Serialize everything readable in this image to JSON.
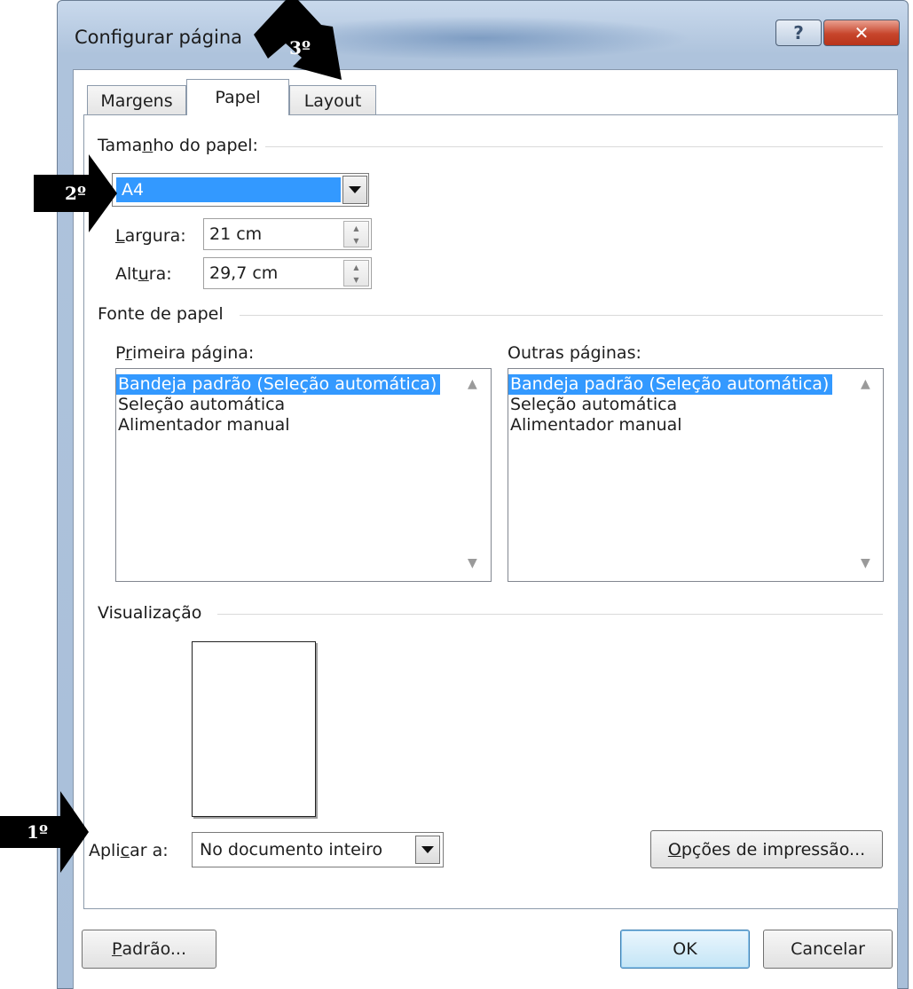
{
  "window": {
    "title": "Configurar página",
    "help_glyph": "?",
    "close_glyph": "✕"
  },
  "tabs": [
    {
      "label": "Margens",
      "active": false
    },
    {
      "label": "Papel",
      "active": true
    },
    {
      "label": "Layout",
      "active": false
    }
  ],
  "paper_size": {
    "group_label_pre": "Tama",
    "group_label_u": "n",
    "group_label_post": "ho do papel:",
    "selected": "A4"
  },
  "width": {
    "label_u": "L",
    "label_post": "argura:",
    "value": "21 cm"
  },
  "height": {
    "label_pre": "Alt",
    "label_u": "u",
    "label_post": "ra:",
    "value": "29,7 cm"
  },
  "paper_source": {
    "group_label": "Fonte de papel",
    "first_page": {
      "label_pre": "P",
      "label_u": "r",
      "label_post": "imeira página:",
      "items": [
        "Bandeja padrão (Seleção automática)",
        "Seleção automática",
        "Alimentador manual"
      ],
      "selected_index": 0
    },
    "other_pages": {
      "label_pre": "Outras pá",
      "label_u": "g",
      "label_post": "inas:",
      "items": [
        "Bandeja padrão (Seleção automática)",
        "Seleção automática",
        "Alimentador manual"
      ],
      "selected_index": 0
    }
  },
  "preview": {
    "group_label": "Visualização"
  },
  "apply_to": {
    "label_pre": "Apli",
    "label_u": "c",
    "label_post": "ar a:",
    "value": "No documento inteiro"
  },
  "buttons": {
    "print_options_u": "O",
    "print_options_post": "pções de impressão...",
    "default_u": "P",
    "default_post": "adrão...",
    "ok": "OK",
    "cancel": "Cancelar"
  },
  "markers": [
    "1º",
    "2º",
    "3º"
  ]
}
